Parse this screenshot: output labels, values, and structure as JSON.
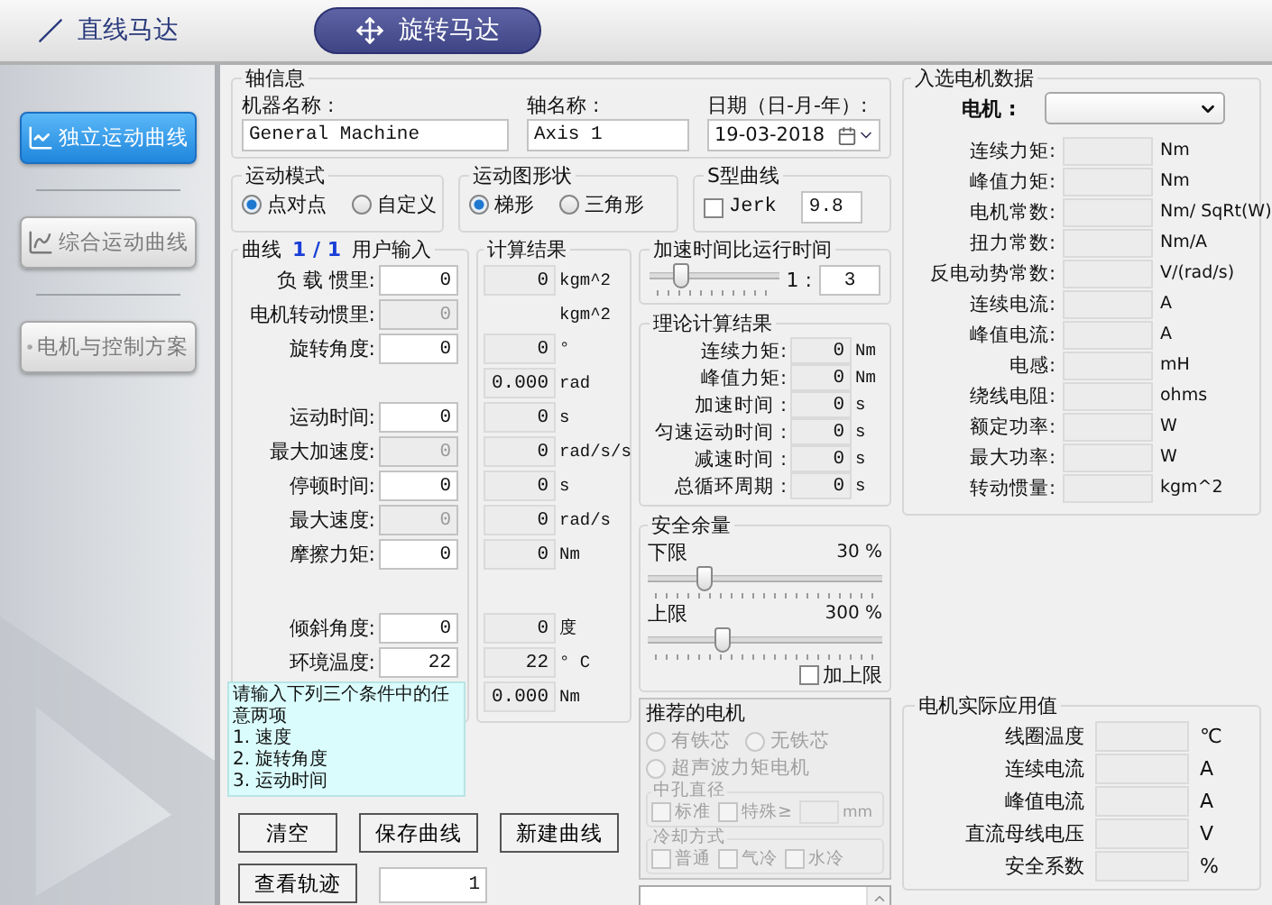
{
  "top_tabs": [
    {
      "label": "直线马达",
      "selected": false
    },
    {
      "label": "旋转马达",
      "selected": true
    }
  ],
  "sidebar": {
    "items": [
      {
        "label": "独立运动曲线",
        "selected": true
      },
      {
        "label": "综合运动曲线",
        "selected": false
      },
      {
        "label": "电机与控制方案",
        "selected": false
      }
    ]
  },
  "axis_info": {
    "title": "轴信息",
    "fields": [
      {
        "label": "机器名称 :",
        "value": "General Machine"
      },
      {
        "label": "轴名称 :",
        "value": "Axis 1"
      },
      {
        "label": "日期（日-月-年）:",
        "value": "19-03-2018"
      }
    ]
  },
  "motion_mode": {
    "title": "运动模式",
    "options": [
      {
        "label": "点对点",
        "selected": true
      },
      {
        "label": "自定义",
        "selected": false
      }
    ]
  },
  "motion_shape": {
    "title": "运动图形状",
    "options": [
      {
        "label": "梯形",
        "selected": true
      },
      {
        "label": "三角形",
        "selected": false
      }
    ]
  },
  "s_curve": {
    "title": "S型曲线",
    "jerk": {
      "label": "Jerk",
      "checked": false
    },
    "value": "9.8"
  },
  "curve": {
    "title": "曲线",
    "counter": "1 / 1",
    "input_header": "用户输入",
    "result_header": "计算结果",
    "rows": [
      {
        "label": "负 载 惯里:",
        "input": "0",
        "input_disabled": false,
        "result": "0",
        "unit": "kgm^2"
      },
      {
        "label": "电机转动惯里:",
        "input": "0",
        "input_disabled": true,
        "unit": "kgm^2"
      },
      {
        "label": "旋转角度:",
        "input": "0",
        "input_disabled": false,
        "result": "0",
        "unit": "°"
      },
      {
        "result": "0.000",
        "unit": "rad"
      },
      {
        "label": "运动时间:",
        "input": "0",
        "input_disabled": false,
        "result": "0",
        "unit": "s"
      },
      {
        "label": "最大加速度:",
        "input": "0",
        "input_disabled": true,
        "result": "0",
        "unit": "rad/s/s"
      },
      {
        "label": "停顿时间:",
        "input": "0",
        "input_disabled": false,
        "result": "0",
        "unit": "s"
      },
      {
        "label": "最大速度:",
        "input": "0",
        "input_disabled": true,
        "result": "0",
        "unit": "rad/s"
      },
      {
        "label": "摩擦力矩:",
        "input": "0",
        "input_disabled": false,
        "result": "0",
        "unit": "Nm"
      }
    ],
    "environment_rows": [
      {
        "label": "倾斜角度:",
        "input": "0",
        "input_disabled": false,
        "result": "0",
        "unit": "度"
      },
      {
        "label": "环境温度:",
        "input": "22",
        "input_disabled": false,
        "result": "22",
        "unit": "° C"
      },
      {
        "result": "0.000",
        "unit": "Nm"
      }
    ]
  },
  "tooltip": {
    "lines": [
      "请输入下列三个条件中的任意两项",
      "1. 速度",
      "2. 旋转角度",
      "3. 运动时间"
    ]
  },
  "buttons": [
    "清空",
    "保存曲线",
    "新建曲线"
  ],
  "trajectory": {
    "button": "查看轨迹",
    "value": "1"
  },
  "accel_ratio": {
    "title": "加速时间比运行时间",
    "level": 0.2,
    "ratio_label": "1 :",
    "value": "3"
  },
  "theory": {
    "title": "理论计算结果",
    "rows": [
      {
        "label": "连续力矩:",
        "value": "0",
        "unit": "Nm"
      },
      {
        "label": "峰值力矩:",
        "value": "0",
        "unit": "Nm"
      },
      {
        "label": "加速时间 :",
        "value": "0",
        "unit": "s"
      },
      {
        "label": "匀速运动时间 :",
        "value": "0",
        "unit": "s"
      },
      {
        "label": "减速时间 :",
        "value": "0",
        "unit": "s"
      },
      {
        "label": "总循环周期 :",
        "value": "0",
        "unit": "s"
      }
    ]
  },
  "safety": {
    "title": "安全余量",
    "sliders": [
      {
        "label": "下限",
        "reading": "30 %",
        "level": 0.22
      },
      {
        "label": "上限",
        "reading": "300 %",
        "level": 0.3
      }
    ],
    "upper_limit": {
      "label": "加上限",
      "checked": false
    }
  },
  "recommended": {
    "title": "推荐的电机",
    "types": [
      {
        "label": "有铁芯",
        "selected": false
      },
      {
        "label": "无铁芯",
        "selected": false
      },
      {
        "label": "超声波力矩电机",
        "selected": false
      }
    ],
    "bore": {
      "title": "中孔直径",
      "options": [
        {
          "label": "标准",
          "checked": false
        },
        {
          "label": "特殊≥",
          "checked": false
        }
      ],
      "unit": "mm"
    },
    "cooling": {
      "title": "冷却方式",
      "options": [
        {
          "label": "普通",
          "checked": false
        },
        {
          "label": "气冷",
          "checked": false
        },
        {
          "label": "水冷",
          "checked": false
        }
      ]
    }
  },
  "motor_data": {
    "title": "入选电机数据",
    "motor_label": "电机 :",
    "rows": [
      {
        "label": "连续力矩:",
        "unit": "Nm"
      },
      {
        "label": "峰值力矩:",
        "unit": "Nm"
      },
      {
        "label": "电机常数:",
        "unit": "Nm/ SqRt(W)"
      },
      {
        "label": "扭力常数:",
        "unit": "Nm/A"
      },
      {
        "label": "反电动势常数:",
        "unit": "V/(rad/s)"
      },
      {
        "label": "连续电流:",
        "unit": "A"
      },
      {
        "label": "峰值电流:",
        "unit": "A"
      },
      {
        "label": "电感:",
        "unit": "mH"
      },
      {
        "label": "绕线电阻:",
        "unit": "ohms"
      },
      {
        "label": "额定功率:",
        "unit": "W"
      },
      {
        "label": "最大功率:",
        "unit": "W"
      },
      {
        "label": "转动惯量:",
        "unit": "kgm^2"
      }
    ]
  },
  "actual": {
    "title": "电机实际应用值",
    "rows": [
      {
        "label": "线圈温度",
        "unit": "℃"
      },
      {
        "label": "连续电流",
        "unit": "A"
      },
      {
        "label": "峰值电流",
        "unit": "A"
      },
      {
        "label": "直流母线电压",
        "unit": "V"
      },
      {
        "label": "安全系数",
        "unit": "%"
      }
    ]
  }
}
